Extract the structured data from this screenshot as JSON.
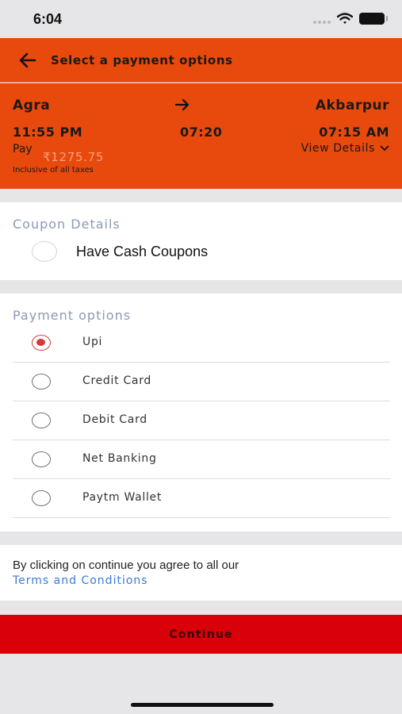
{
  "status_bar": {
    "time": "6:04"
  },
  "header": {
    "title": "Select a payment options"
  },
  "trip": {
    "from": "Agra",
    "to": "Akbarpur",
    "departure_time": "11:55 PM",
    "duration": "07:20",
    "arrival_time": "07:15 AM",
    "pay_label": "Pay",
    "amount": "₹1275.75",
    "taxes_note": "Inclusive of all taxes",
    "view_details_label": "View  Details"
  },
  "coupon": {
    "section_title": "Coupon Details",
    "option_label": "Have Cash Coupons",
    "selected": false
  },
  "payment": {
    "section_title": "Payment options",
    "options": [
      {
        "label": "Upi",
        "selected": true
      },
      {
        "label": "Credit Card",
        "selected": false
      },
      {
        "label": "Debit Card",
        "selected": false
      },
      {
        "label": "Net Banking",
        "selected": false
      },
      {
        "label": "Paytm Wallet",
        "selected": false
      }
    ]
  },
  "terms": {
    "text": "By clicking on continue you agree to all our",
    "link_label": "Terms and Conditions"
  },
  "continue_label": "Continue",
  "colors": {
    "brand_orange": "#e8490d",
    "continue_red": "#d9000a",
    "selected_radio": "#d43a3a",
    "link_blue": "#3a7bd5",
    "section_title": "#8b9bb3"
  }
}
